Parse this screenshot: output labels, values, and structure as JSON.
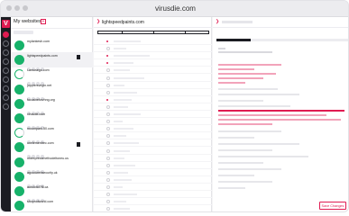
{
  "window": {
    "title": "virusdie.com"
  },
  "colors": {
    "accent": "#e01b52",
    "green": "#17b26a",
    "dark": "#1b1c22"
  },
  "sidebar_rail": {
    "logo_letter": "V",
    "items": [
      "dashboard-icon",
      "circle-icon",
      "circle-icon",
      "circle-icon",
      "circle-icon",
      "circle-icon",
      "circle-icon",
      "circle-icon",
      "circle-icon"
    ]
  },
  "sites_panel": {
    "header": "My websites",
    "add_label": "+",
    "sites": [
      {
        "name": "mylankesh.com",
        "status": "ok",
        "flag": false,
        "selected": false
      },
      {
        "name": "lightspeedpaints.com",
        "status": "ok",
        "flag": true,
        "selected": true
      },
      {
        "name": "i-amusego.com",
        "status": "scan",
        "flag": false,
        "selected": false
      },
      {
        "name": "juppiersvirgin.net",
        "status": "ok",
        "flag": false,
        "selected": false
      },
      {
        "name": "focusbeforvhng.org",
        "status": "ok",
        "flag": false,
        "selected": false
      },
      {
        "name": "virusdie.com",
        "status": "ok",
        "flag": false,
        "selected": false
      },
      {
        "name": "mountpark.50.com",
        "status": "scan",
        "flag": false,
        "selected": false
      },
      {
        "name": "onelementrec.com",
        "status": "ok",
        "flag": true,
        "selected": false
      },
      {
        "name": "oldexpressmethodeltoneu.us",
        "status": "ok",
        "flag": false,
        "selected": false
      },
      {
        "name": "agoodwebsecurity.uk",
        "status": "ok",
        "flag": false,
        "selected": false
      },
      {
        "name": "autolotid7f6.ca",
        "status": "ok",
        "flag": false,
        "selected": false
      },
      {
        "name": "shopnotworld.com",
        "status": "ok",
        "flag": false,
        "selected": false
      }
    ]
  },
  "files_panel": {
    "path": "lightspeedpaints.com",
    "rows": [
      {
        "red": true,
        "bar": 30
      },
      {
        "red": false,
        "bar": 14
      },
      {
        "red": true,
        "bar": 40
      },
      {
        "red": true,
        "bar": 22
      },
      {
        "red": false,
        "bar": 18
      },
      {
        "red": false,
        "bar": 34
      },
      {
        "red": false,
        "bar": 12
      },
      {
        "red": false,
        "bar": 26
      },
      {
        "red": true,
        "bar": 20
      },
      {
        "red": false,
        "bar": 16
      },
      {
        "red": false,
        "bar": 30
      },
      {
        "red": false,
        "bar": 10
      },
      {
        "red": false,
        "bar": 22
      },
      {
        "red": false,
        "bar": 14
      },
      {
        "red": false,
        "bar": 28
      },
      {
        "red": false,
        "bar": 18
      },
      {
        "red": false,
        "bar": 12
      },
      {
        "red": false,
        "bar": 24
      },
      {
        "red": false,
        "bar": 16
      },
      {
        "red": false,
        "bar": 20
      },
      {
        "red": false,
        "bar": 10
      },
      {
        "red": false,
        "bar": 26
      },
      {
        "red": false,
        "bar": 14
      },
      {
        "red": false,
        "bar": 18
      }
    ]
  },
  "editor_panel": {
    "save_label": "Save Changes"
  }
}
